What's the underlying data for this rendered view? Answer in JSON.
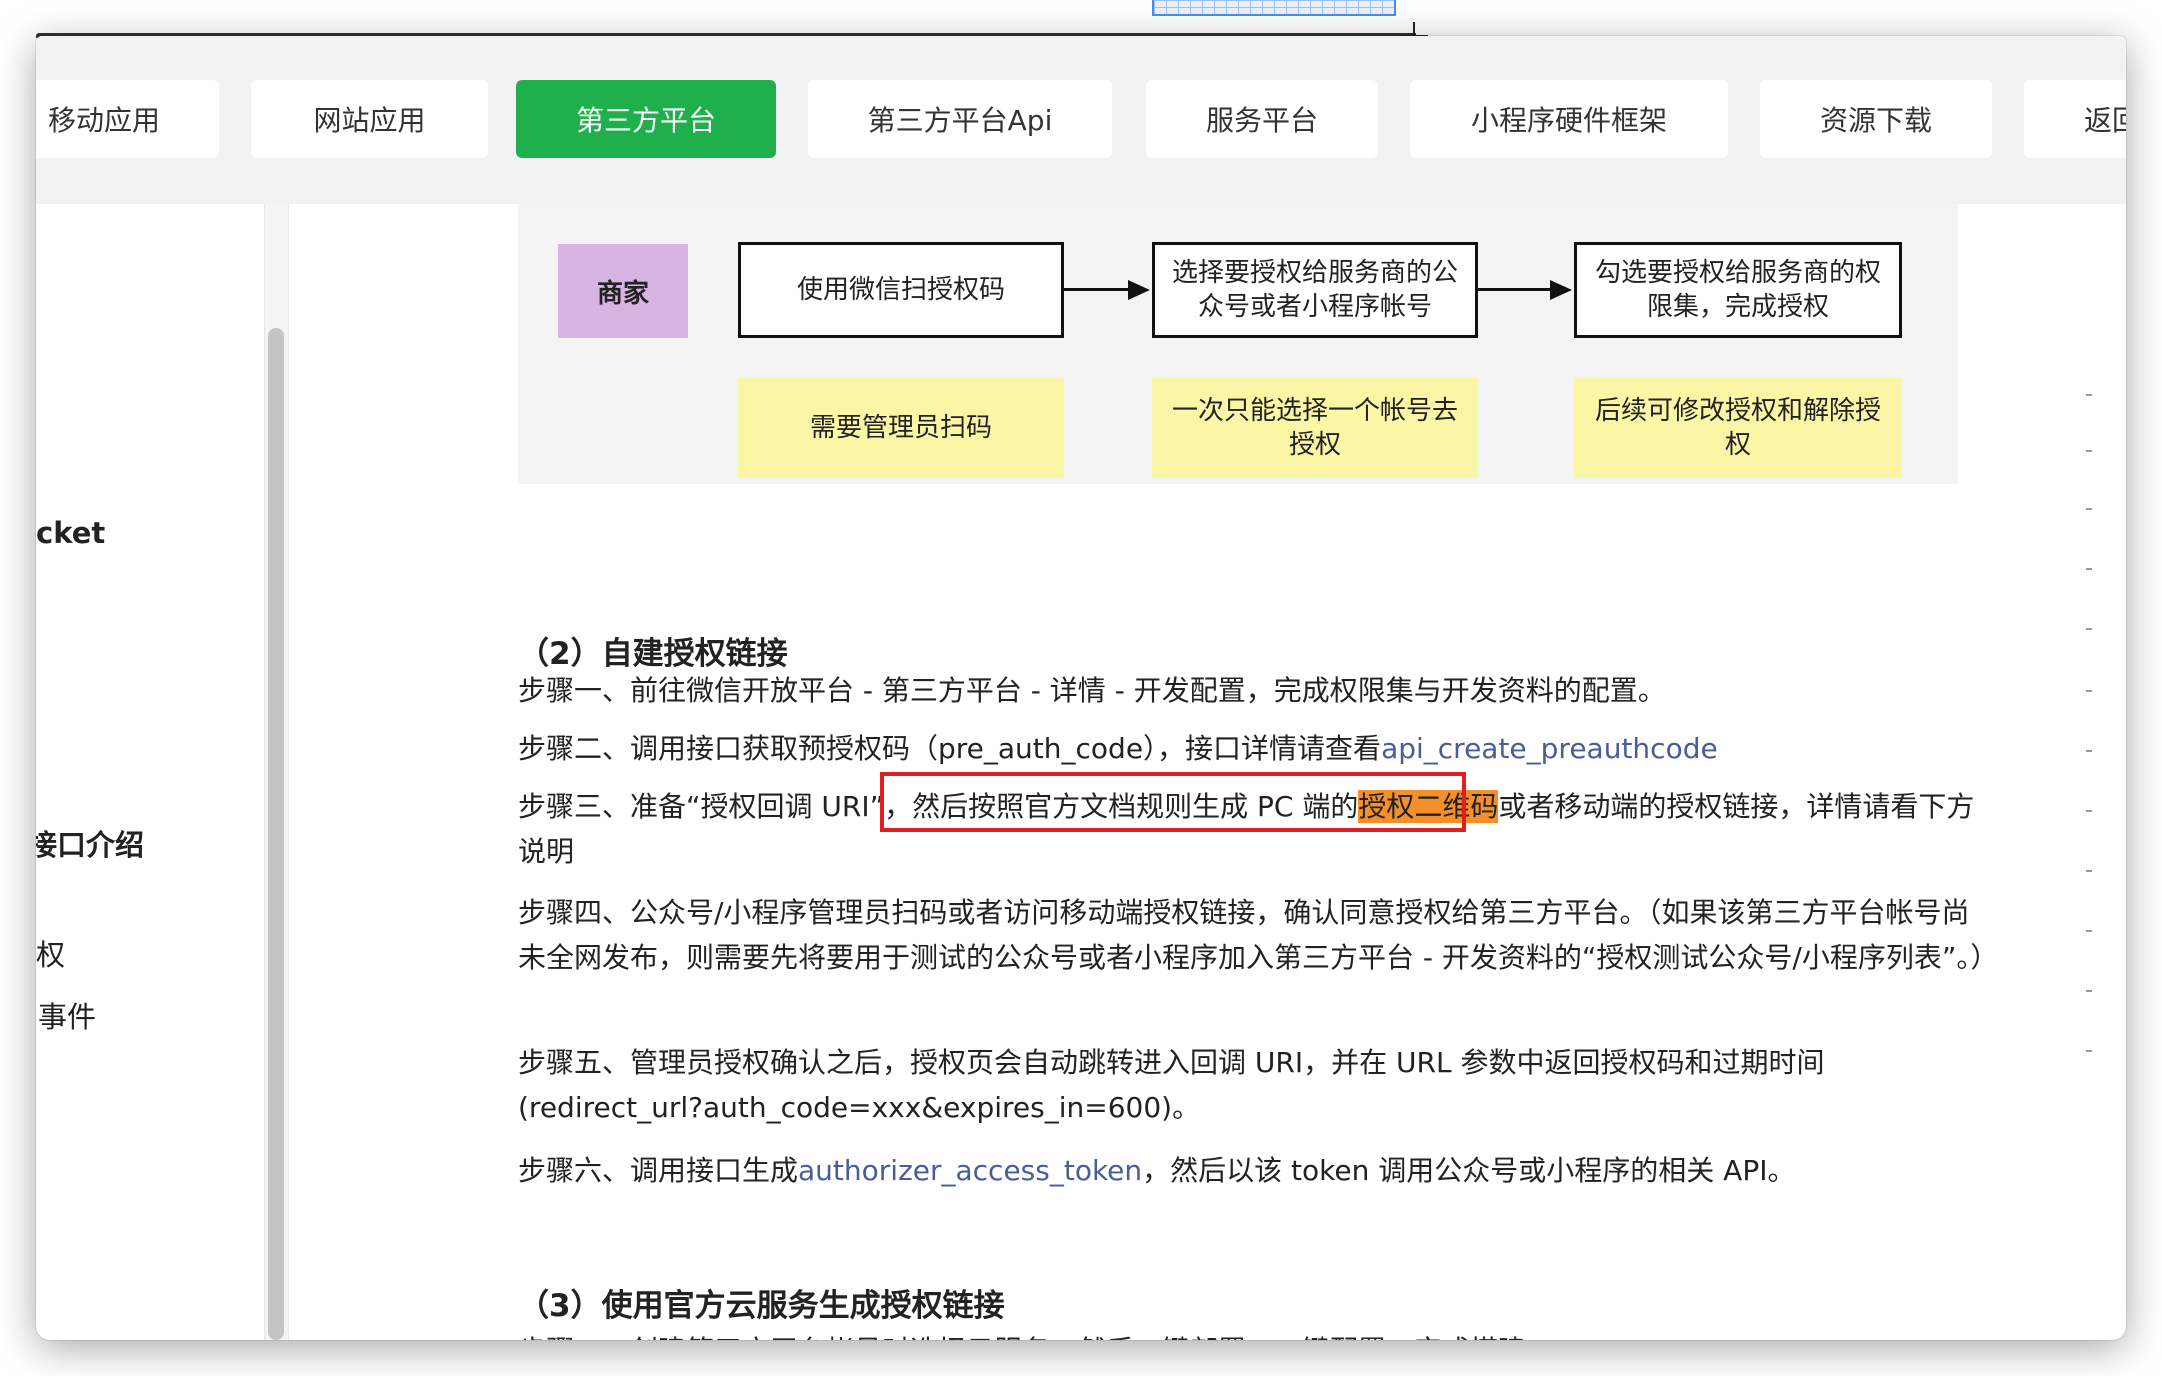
{
  "nav": {
    "tabs": [
      {
        "label": "移动应用",
        "active": false
      },
      {
        "label": "网站应用",
        "active": false
      },
      {
        "label": "第三方平台",
        "active": true
      },
      {
        "label": "第三方平台Api",
        "active": false
      },
      {
        "label": "服务平台",
        "active": false
      },
      {
        "label": "小程序硬件框架",
        "active": false
      },
      {
        "label": "资源下载",
        "active": false
      },
      {
        "label": "返回",
        "active": false
      }
    ]
  },
  "sidebar": {
    "items": [
      "cket",
      "接口介绍",
      "权",
      "事件"
    ]
  },
  "diagram": {
    "role": "商家",
    "steps": [
      "使用微信扫授权码",
      "选择要授权给服务商的公众号或者小程序帐号",
      "勾选要授权给服务商的权限集，完成授权"
    ],
    "notes": [
      "需要管理员扫码",
      "一次只能选择一个帐号去授权",
      "后续可修改授权和解除授权"
    ]
  },
  "section2": {
    "heading": "（2）自建授权链接",
    "step1": "步骤一、前往微信开放平台 - 第三方平台 - 详情 - 开发配置，完成权限集与开发资料的配置。",
    "step2_prefix": "步骤二、调用接口获取预授权码（pre_auth_code），接口详情请查看",
    "step2_link": "api_create_preauthcode",
    "step3_prefix": "步骤三、准备“授权回调 URI”，然后按照官方文档规则生成 PC 端的",
    "step3_highlight": "授权二维码",
    "step3_suffix": "或者移动端的授权链接，详情请看下方说明",
    "step4": "步骤四、公众号/小程序管理员扫码或者访问移动端授权链接，确认同意授权给第三方平台。（如果该第三方平台帐号尚未全网发布，则需要先将要用于测试的公众号或者小程序加入第三方平台 - 开发资料的“授权测试公众号/小程序列表”。）",
    "step5": "步骤五、管理员授权确认之后，授权页会自动跳转进入回调 URI，并在 URL 参数中返回授权码和过期时间(redirect_url?auth_code=xxx&expires_in=600)。",
    "step6_prefix": "步骤六、调用接口生成",
    "step6_link": "authorizer_access_token",
    "step6_suffix": "，然后以该 token 调用公众号或小程序的相关 API。"
  },
  "section3": {
    "heading": "（3）使用官方云服务生成授权链接",
    "step1": "步骤一、创建第三方平台帐号时选择云服务，然后一键部署、一键配置，完成搭建。"
  },
  "colors": {
    "accent": "#1fb04d",
    "link": "#4a5c9a",
    "highlight": "#f58f2c",
    "annotation": "#e02020",
    "role_box": "#d8b4e2",
    "note_box": "#fbf5a6"
  }
}
